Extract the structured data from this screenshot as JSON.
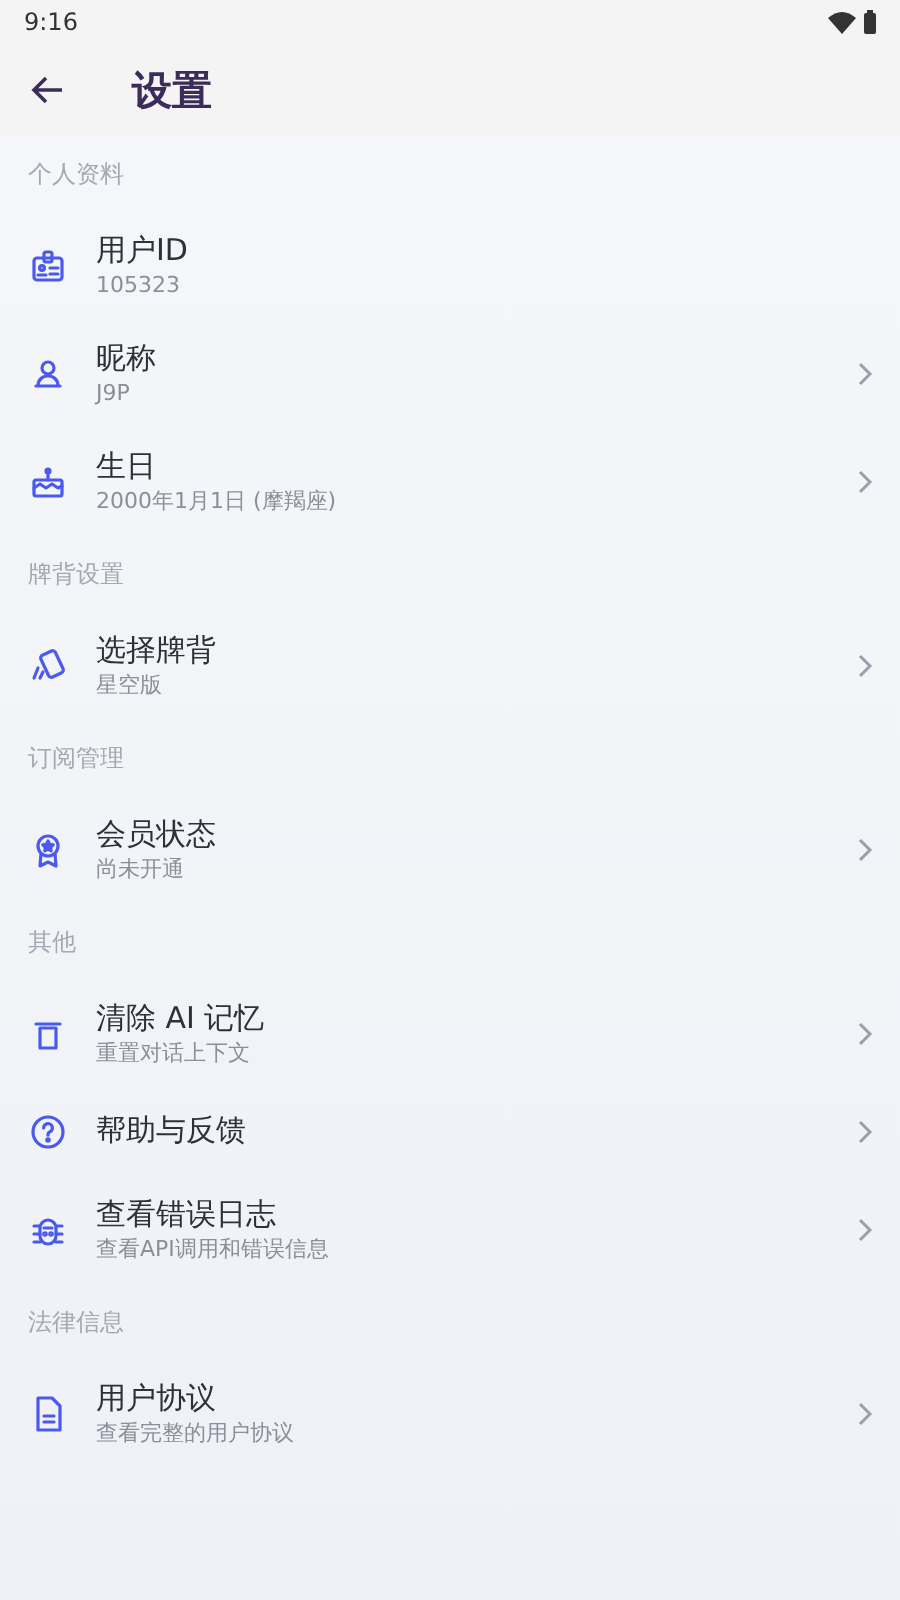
{
  "status_bar": {
    "time": "9:16"
  },
  "app_bar": {
    "title": "设置"
  },
  "sections": [
    {
      "header": "个人资料",
      "items": [
        {
          "title": "用户ID",
          "subtitle": "105323",
          "chevron": false
        },
        {
          "title": "昵称",
          "subtitle": "J9P",
          "chevron": true
        },
        {
          "title": "生日",
          "subtitle": "2000年1月1日 (摩羯座)",
          "chevron": true
        }
      ]
    },
    {
      "header": "牌背设置",
      "items": [
        {
          "title": "选择牌背",
          "subtitle": "星空版",
          "chevron": true
        }
      ]
    },
    {
      "header": "订阅管理",
      "items": [
        {
          "title": "会员状态",
          "subtitle": "尚未开通",
          "chevron": true
        }
      ]
    },
    {
      "header": "其他",
      "items": [
        {
          "title": "清除 AI 记忆",
          "subtitle": "重置对话上下文",
          "chevron": true
        },
        {
          "title": "帮助与反馈",
          "chevron": true
        },
        {
          "title": "查看错误日志",
          "subtitle": "查看API调用和错误信息",
          "chevron": true
        }
      ]
    },
    {
      "header": "法律信息",
      "items": [
        {
          "title": "用户协议",
          "subtitle": "查看完整的用户协议",
          "chevron": true
        }
      ]
    }
  ]
}
